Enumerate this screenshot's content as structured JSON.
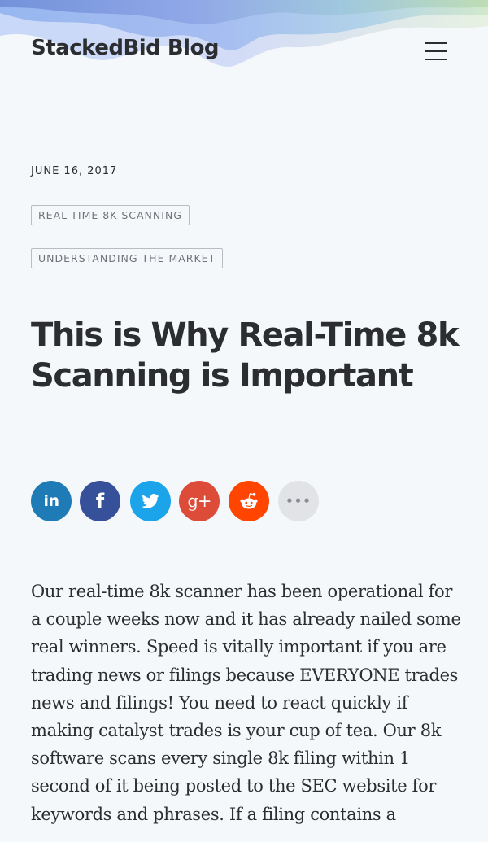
{
  "header": {
    "site_title": "StackedBid Blog"
  },
  "post": {
    "date": "JUNE 16, 2017",
    "tags": [
      "REAL-TIME 8K SCANNING",
      "UNDERSTANDING THE MARKET"
    ],
    "title": "This is Why Real-Time 8k Scanning is Important",
    "body": "Our real-time 8k scanner has been operational for a couple weeks now and it has already nailed some real winners. Speed is vitally important if you are trading news or filings because EVERYONE trades news and filings! You need to react quickly if making catalyst trades is your cup of tea. Our 8k software scans every single 8k filing within 1 second of it being posted to the SEC website for keywords and phrases. If a filing contains a"
  },
  "share": {
    "buttons": [
      {
        "name": "linkedin",
        "label": "in",
        "color": "#1f7bb6"
      },
      {
        "name": "facebook",
        "label": "f",
        "color": "#36509a"
      },
      {
        "name": "twitter",
        "label": "",
        "color": "#1ba4ea"
      },
      {
        "name": "google-plus",
        "label": "g+",
        "color": "#dd4b39"
      },
      {
        "name": "reddit",
        "label": "",
        "color": "#ff4500"
      },
      {
        "name": "more",
        "label": "•••",
        "color": "#e1e3e6"
      }
    ]
  }
}
